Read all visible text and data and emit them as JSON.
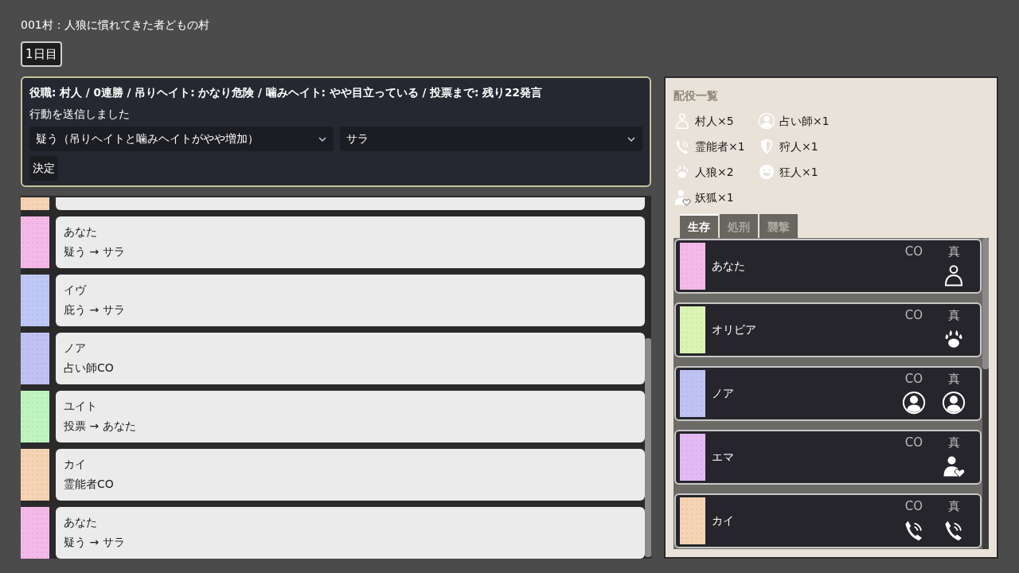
{
  "title": "001村：人狼に慣れてきた者どもの村",
  "day_button": "1日目",
  "action_panel": {
    "status": "役職: 村人 / 0連勝 / 吊りヘイト: かなり危険 / 噛みヘイト: やや目立っている / 投票まで: 残り22発言",
    "message": "行動を送信しました",
    "action_select": "疑う（吊りヘイトと噛みヘイトがやや増加）",
    "target_select": "サラ",
    "submit": "決定"
  },
  "log": [
    {
      "kind": "cut",
      "color": "#f5d3b3"
    },
    {
      "kind": "entry",
      "name": "あなた",
      "text": "疑う → サラ",
      "color": "#f4b9e8"
    },
    {
      "kind": "entry",
      "name": "イヴ",
      "text": "庇う → サラ",
      "color": "#bfc8f4"
    },
    {
      "kind": "entry",
      "name": "ノア",
      "text": "占い師CO",
      "color": "#bfc3f4"
    },
    {
      "kind": "entry",
      "name": "ユイト",
      "text": "投票 → あなた",
      "color": "#bff4bf"
    },
    {
      "kind": "entry",
      "name": "カイ",
      "text": "霊能者CO",
      "color": "#f5d3b3"
    },
    {
      "kind": "entry",
      "name": "あなた",
      "text": "疑う → サラ",
      "color": "#f4b9e8"
    }
  ],
  "roles_panel": {
    "title": "配役一覧",
    "roles": [
      {
        "kind": "villager",
        "label": "村人×5"
      },
      {
        "kind": "seer",
        "label": "占い師×1"
      },
      {
        "kind": "medium",
        "label": "霊能者×1"
      },
      {
        "kind": "hunter",
        "label": "狩人×1"
      },
      {
        "kind": "werewolf",
        "label": "人狼×2"
      },
      {
        "kind": "madman",
        "label": "狂人×1"
      },
      {
        "kind": "fox",
        "label": "妖狐×1"
      }
    ],
    "tabs": [
      {
        "label": "生存",
        "selected": true
      },
      {
        "label": "処刑",
        "selected": false
      },
      {
        "label": "襲撃",
        "selected": false
      }
    ],
    "players": [
      {
        "name": "あなた",
        "color": "#f4b9e8",
        "co_header": "CO",
        "true_header": "真",
        "true_role": {
          "kind": "villager"
        }
      },
      {
        "name": "オリビア",
        "color": "#dcf4b3",
        "co_header": "CO",
        "true_header": "真",
        "true_role": {
          "kind": "werewolf"
        }
      },
      {
        "name": "ノア",
        "color": "#bfc3f4",
        "co_header": "CO",
        "true_header": "真",
        "co": {
          "kind": "seer"
        },
        "true_role": {
          "kind": "seer"
        }
      },
      {
        "name": "エマ",
        "color": "#e3b9f4",
        "co_header": "CO",
        "true_header": "真",
        "true_role": {
          "kind": "fox"
        }
      },
      {
        "name": "カイ",
        "color": "#f5d3b3",
        "co_header": "CO",
        "true_header": "真",
        "co": {
          "kind": "medium"
        },
        "true_role": {
          "kind": "medium"
        }
      }
    ]
  }
}
